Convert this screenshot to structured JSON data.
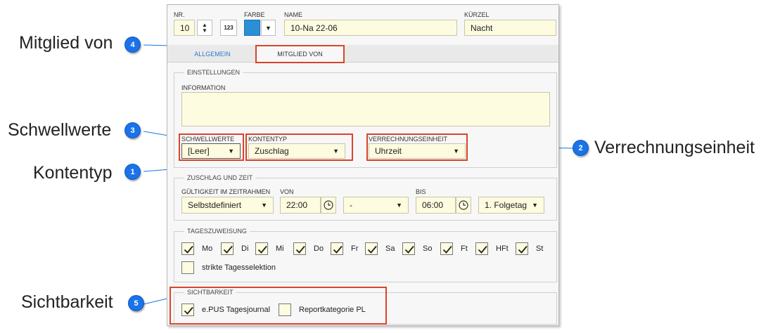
{
  "header": {
    "nr_label": "NR.",
    "nr_value": "10",
    "num_button": "123",
    "color_label": "FARBE",
    "color_value": "#2b8fd6",
    "name_label": "NAME",
    "name_value": "10-Na 22-06",
    "short_label": "KÜRZEL",
    "short_value": "Nacht"
  },
  "tabs": [
    {
      "label": "ALLGEMEIN"
    },
    {
      "label": "MITGLIED VON"
    }
  ],
  "settings": {
    "title": "EINSTELLUNGEN",
    "info_label": "INFORMATION",
    "info_value": "",
    "threshold_label": "SCHWELLWERTE",
    "threshold_value": "[Leer]",
    "account_type_label": "KONTENTYP",
    "account_type_value": "Zuschlag",
    "billing_unit_label": "VERRECHNUNGSEINHEIT",
    "billing_unit_value": "Uhrzeit"
  },
  "surcharge": {
    "title": "ZUSCHLAG UND ZEIT",
    "validity_label": "GÜLTIGKEIT IM ZEITRAHMEN",
    "validity_value": "Selbstdefiniert",
    "from_label": "VON",
    "from_value": "22:00",
    "from_day_value": "-",
    "to_label": "BIS",
    "to_value": "06:00",
    "to_day_value": "1. Folgetag"
  },
  "days": {
    "title": "TAGESZUWEISUNG",
    "items": [
      {
        "label": "Mo",
        "checked": true
      },
      {
        "label": "Di",
        "checked": true
      },
      {
        "label": "Mi",
        "checked": true
      },
      {
        "label": "Do",
        "checked": true
      },
      {
        "label": "Fr",
        "checked": true
      },
      {
        "label": "Sa",
        "checked": true
      },
      {
        "label": "So",
        "checked": true
      },
      {
        "label": "Ft",
        "checked": true
      },
      {
        "label": "HFt",
        "checked": true
      },
      {
        "label": "St",
        "checked": true
      }
    ],
    "strict_label": "strikte Tagesselektion",
    "strict_checked": false
  },
  "visibility": {
    "title": "SICHTBARKEIT",
    "journal_label": "e.PUS Tagesjournal",
    "journal_checked": true,
    "report_label": "Reportkategorie PL",
    "report_checked": false
  },
  "callouts": [
    {
      "number": "1",
      "text": "Kontentyp"
    },
    {
      "number": "2",
      "text": "Verrechnungseinheit"
    },
    {
      "number": "3",
      "text": "Schwellwerte"
    },
    {
      "number": "4",
      "text": "Mitglied von"
    },
    {
      "number": "5",
      "text": "Sichtbarkeit"
    }
  ],
  "colors": {
    "badge": "#1a73e8",
    "highlight": "#d7452a",
    "field_bg": "#fdfbe0",
    "active_tab": "#2a7bd4"
  }
}
